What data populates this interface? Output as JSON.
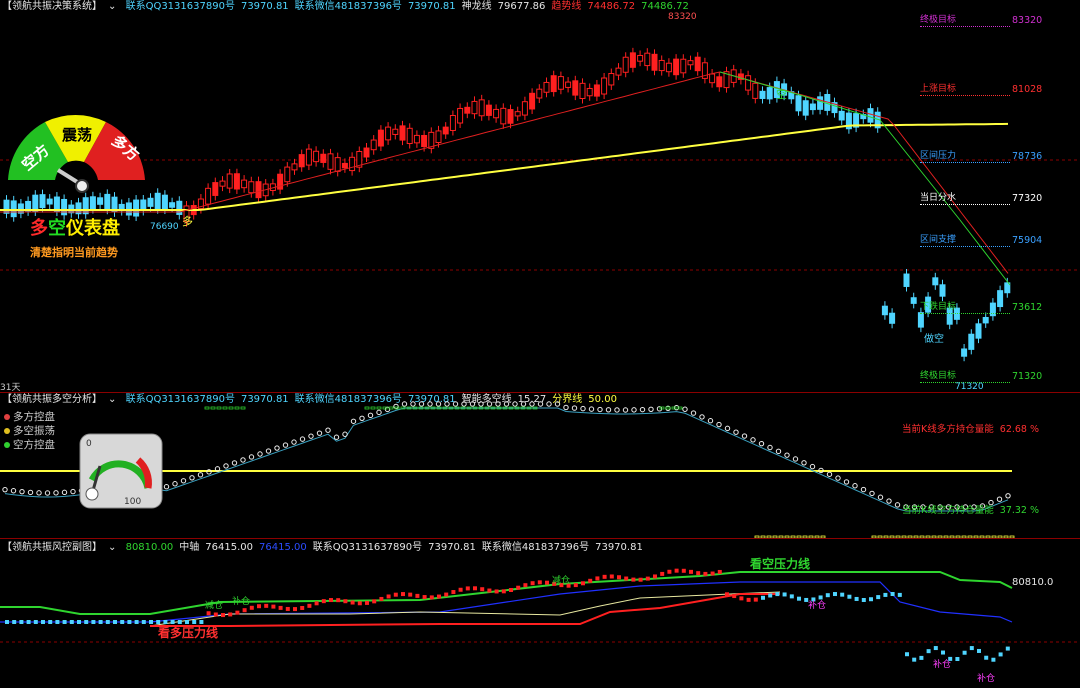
{
  "panel1": {
    "title": "【领航共振决策系统】",
    "items": [
      {
        "t": "联系QQ3131637890号",
        "c": "c-cyan"
      },
      {
        "t": "73970.81",
        "c": "c-cyan"
      },
      {
        "t": "联系微信481837396号",
        "c": "c-cyan"
      },
      {
        "t": "73970.81",
        "c": "c-cyan"
      },
      {
        "t": "神龙线",
        "c": "c-white"
      },
      {
        "t": "79677.86",
        "c": "c-white"
      },
      {
        "t": "趋势线",
        "c": "c-red"
      },
      {
        "t": "74486.72",
        "c": "c-red"
      },
      {
        "t": "74486.72",
        "c": "c-green"
      }
    ],
    "peak_label": "83320",
    "low_label": "76690",
    "low2_label": "71320",
    "duo_label": "多",
    "kong_label": "空",
    "kong2_label": "做空",
    "gauge": {
      "left": "空方",
      "mid": "震荡",
      "right": "多方",
      "title_duo": "多",
      "title_kong": "空",
      "title_rest": "仪表盘",
      "subtitle": "清楚指明当前趋势"
    },
    "period_label": "31天",
    "levels": [
      {
        "name": "终极目标",
        "value": "83320",
        "color": "#d030d0"
      },
      {
        "name": "上涨目标",
        "value": "81028",
        "color": "#ff3030"
      },
      {
        "name": "区间压力",
        "value": "78736",
        "color": "#3aa0ff"
      },
      {
        "name": "当日分水",
        "value": "77320",
        "color": "#ffffff"
      },
      {
        "name": "区间支撑",
        "value": "75904",
        "color": "#3aa0ff"
      },
      {
        "name": "下跌目标",
        "value": "73612",
        "color": "#2fd52f"
      },
      {
        "name": "终极目标",
        "value": "71320",
        "color": "#2fd52f"
      }
    ]
  },
  "panel2": {
    "title": "【领航共振多空分析】",
    "items": [
      {
        "t": "联系QQ3131637890号",
        "c": "c-cyan"
      },
      {
        "t": "73970.81",
        "c": "c-cyan"
      },
      {
        "t": "联系微信481837396号",
        "c": "c-cyan"
      },
      {
        "t": "73970.81",
        "c": "c-cyan"
      },
      {
        "t": "智能多空线",
        "c": "c-white"
      },
      {
        "t": "15.27",
        "c": "c-white"
      },
      {
        "t": "分界线",
        "c": "c-yellow"
      },
      {
        "t": "50.00",
        "c": "c-yellow"
      }
    ],
    "legend": [
      {
        "t": "多方控盘",
        "color": "#e04040"
      },
      {
        "t": "多空振荡",
        "color": "#e0c020"
      },
      {
        "t": "空方控盘",
        "color": "#30d030"
      }
    ],
    "gauge_min": "0",
    "gauge_max": "100",
    "long_text": "当前K线多方持仓量能",
    "long_value": "62.68",
    "short_text": "当前K线空方持仓量能",
    "short_value": "37.32",
    "pct": "%"
  },
  "panel3": {
    "title": "【领航共振风控副图】",
    "items": [
      {
        "t": "80810.00",
        "c": "c-green"
      },
      {
        "t": "中轴",
        "c": "c-white"
      },
      {
        "t": "76415.00",
        "c": "c-white"
      },
      {
        "t": "76415.00",
        "c": "c-blue"
      },
      {
        "t": "联系QQ3131637890号",
        "c": "c-white"
      },
      {
        "t": "73970.81",
        "c": "c-white"
      },
      {
        "t": "联系微信481837396号",
        "c": "c-white"
      },
      {
        "t": "73970.81",
        "c": "c-white"
      }
    ],
    "pressure_kong": "看空压力线",
    "pressure_duo": "看多压力线",
    "right_value": "80810.0",
    "tags": {
      "jian": "减仓",
      "bu": "补仓"
    }
  }
}
